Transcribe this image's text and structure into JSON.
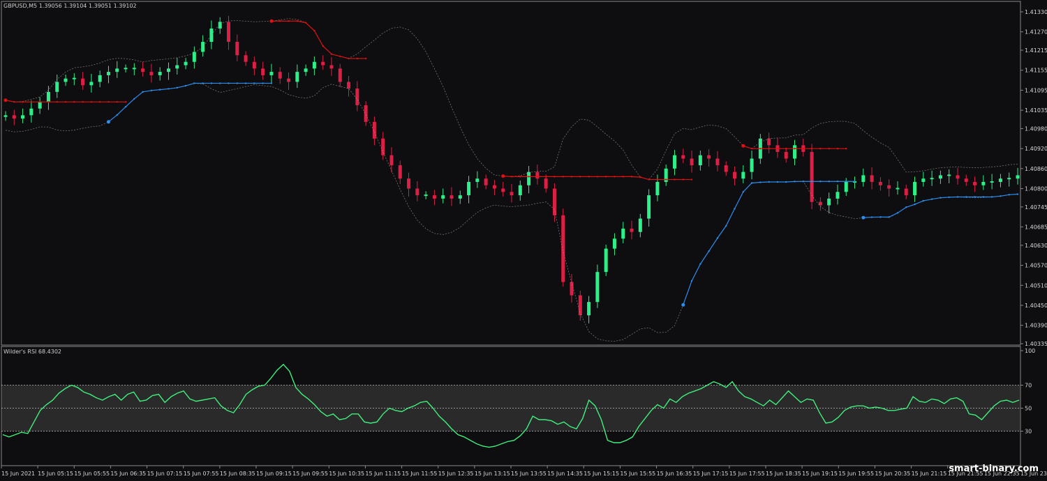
{
  "window": {
    "symbol_label": "GBPUSD,M5",
    "ohlc_label": "1.39056 1.39104 1.39051 1.39102"
  },
  "rsi_panel": {
    "title": "Wilder's RSI 68.4302",
    "levels": [
      70,
      50,
      30
    ],
    "scale_labels": [
      "100",
      "70",
      "50",
      "30"
    ]
  },
  "watermark": "smart-binary.com",
  "colors": {
    "background": "#0e0e10",
    "bull_candle": "#2ef08a",
    "bear_candle": "#dc1f45",
    "resistance_line": "#e31010",
    "support_line": "#2a8df0",
    "rsi_line": "#3ef07c",
    "bands": "#a0a0a0",
    "rsi_band_fill": "#2a2a2a"
  },
  "chart_data": [
    {
      "type": "candlestick",
      "title": "GBPUSD,M5",
      "y_tick_labels": [
        "1.41330",
        "1.41270",
        "1.41215",
        "1.41155",
        "1.41095",
        "1.41035",
        "1.40980",
        "1.40920",
        "1.40860",
        "1.40800",
        "1.40745",
        "1.40685",
        "1.40630",
        "1.40570",
        "1.40510",
        "1.40450",
        "1.40390",
        "1.40335"
      ],
      "ylim": [
        1.40335,
        1.4133
      ],
      "x_tick_labels": [
        "15 Jun 2021",
        "15 Jun 05:15",
        "15 Jun 05:55",
        "15 Jun 06:35",
        "15 Jun 07:15",
        "15 Jun 07:55",
        "15 Jun 08:35",
        "15 Jun 09:15",
        "15 Jun 09:55",
        "15 Jun 10:35",
        "15 Jun 11:15",
        "15 Jun 11:55",
        "15 Jun 12:35",
        "15 Jun 13:15",
        "15 Jun 13:55",
        "15 Jun 14:35",
        "15 Jun 15:15",
        "15 Jun 15:55",
        "15 Jun 16:35",
        "15 Jun 17:15",
        "15 Jun 17:55",
        "15 Jun 18:35",
        "15 Jun 19:15",
        "15 Jun 19:55",
        "15 Jun 20:35",
        "15 Jun 21:15",
        "15 Jun 21:55",
        "15 Jun 22:35",
        "15 Jun 23:1"
      ],
      "close_series": [
        1.4102,
        1.4101,
        1.4102,
        1.4104,
        1.4106,
        1.4109,
        1.4112,
        1.4113,
        1.4113,
        1.4111,
        1.4112,
        1.4114,
        1.4115,
        1.4116,
        1.4116,
        1.4116,
        1.4115,
        1.4114,
        1.4115,
        1.4116,
        1.4117,
        1.4118,
        1.4121,
        1.4124,
        1.4128,
        1.413,
        1.4124,
        1.412,
        1.4118,
        1.4116,
        1.4114,
        1.4115,
        1.4113,
        1.4112,
        1.4115,
        1.4116,
        1.4118,
        1.4117,
        1.4116,
        1.4112,
        1.411,
        1.4105,
        1.41,
        1.4095,
        1.409,
        1.4087,
        1.4083,
        1.408,
        1.4078,
        1.4078,
        1.4077,
        1.4078,
        1.4077,
        1.4078,
        1.4082,
        1.4083,
        1.4081,
        1.408,
        1.4079,
        1.4078,
        1.4081,
        1.4085,
        1.4083,
        1.408,
        1.4072,
        1.4052,
        1.4048,
        1.4042,
        1.4046,
        1.4055,
        1.4062,
        1.4065,
        1.4068,
        1.4067,
        1.4071,
        1.4078,
        1.4082,
        1.4086,
        1.409,
        1.4089,
        1.4087,
        1.409,
        1.4089,
        1.4087,
        1.4085,
        1.4083,
        1.4085,
        1.4089,
        1.4095,
        1.4093,
        1.4091,
        1.4089,
        1.4093,
        1.4091,
        1.4076,
        1.4075,
        1.4077,
        1.4079,
        1.4082,
        1.4082,
        1.4084,
        1.4082,
        1.4081,
        1.408,
        1.408,
        1.4078,
        1.4082,
        1.4083,
        1.4083,
        1.4084,
        1.4084,
        1.4083,
        1.4082,
        1.4081,
        1.4082,
        1.4082,
        1.4083,
        1.4083,
        1.4084
      ],
      "series": [
        {
          "name": "",
          "type": "line",
          "color": "#e31010"
        },
        {
          "name": "",
          "type": "line",
          "color": "#2a8df0"
        },
        {
          "name": "",
          "type": "band",
          "color": "#a0a0a0"
        }
      ]
    },
    {
      "type": "line",
      "title": "Wilder's RSI 68.4302",
      "ylim": [
        0,
        100
      ],
      "y_tick_labels": [
        "100",
        "70",
        "50",
        "30"
      ],
      "series": [
        {
          "name": "Wilder's RSI",
          "values": [
            27,
            25,
            27,
            29,
            28,
            38,
            48,
            53,
            57,
            63,
            67,
            70,
            68,
            64,
            62,
            59,
            57,
            60,
            62,
            57,
            62,
            64,
            56,
            57,
            61,
            62,
            55,
            60,
            63,
            65,
            58,
            56,
            57,
            58,
            59,
            52,
            48,
            46,
            53,
            62,
            66,
            69,
            70,
            76,
            83,
            88,
            82,
            68,
            62,
            58,
            53,
            47,
            43,
            45,
            40,
            41,
            45,
            45,
            38,
            37,
            38,
            45,
            50,
            48,
            47,
            50,
            52,
            55,
            56,
            50,
            43,
            38,
            32,
            27,
            25,
            22,
            19,
            17,
            16,
            17,
            19,
            21,
            22,
            26,
            32,
            43,
            40,
            40,
            39,
            36,
            38,
            34,
            32,
            41,
            57,
            52,
            40,
            22,
            20,
            20,
            22,
            25,
            34,
            41,
            48,
            53,
            50,
            58,
            55,
            60,
            63,
            65,
            67,
            70,
            73,
            71,
            68,
            73,
            65,
            60,
            58,
            55,
            52,
            57,
            53,
            59,
            65,
            60,
            55,
            58,
            57,
            46,
            37,
            38,
            42,
            48,
            51,
            52,
            52,
            50,
            51,
            50,
            48,
            48,
            49,
            50,
            60,
            56,
            55,
            58,
            57,
            54,
            58,
            59,
            56,
            45,
            44,
            40,
            46,
            52,
            56,
            57,
            55,
            57
          ]
        }
      ],
      "levels": [
        70,
        50,
        30
      ]
    }
  ]
}
